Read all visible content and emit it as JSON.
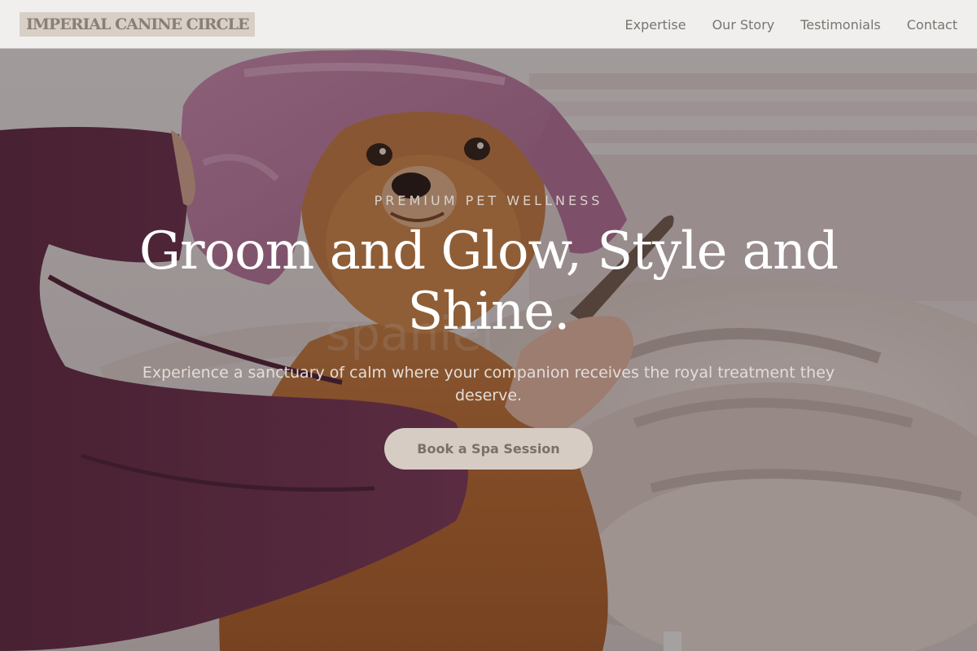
{
  "navbar": {
    "logo_text": "IMPERIAL CANINE CIRCLE",
    "links": [
      "Expertise",
      "Our Story",
      "Testimonials",
      "Contact"
    ]
  },
  "hero": {
    "eyebrow": "PREMIUM PET WELLNESS",
    "headline": "Groom and Glow, Style and Shine.",
    "subtext": "Experience a sanctuary of calm where your companion receives the royal treatment they deserve.",
    "cta_label": "Book a Spa Session",
    "watermark_text": "spaniel",
    "image_description_icon": "dog-grooming-photo"
  },
  "colors": {
    "nav_background": "#f0efed",
    "logo_background": "#d8cfc6",
    "logo_text": "#8a7f76",
    "nav_link": "#7a7470",
    "cta_background": "#d6ccc4",
    "cta_text": "#7a706a",
    "headline": "#ffffff"
  }
}
